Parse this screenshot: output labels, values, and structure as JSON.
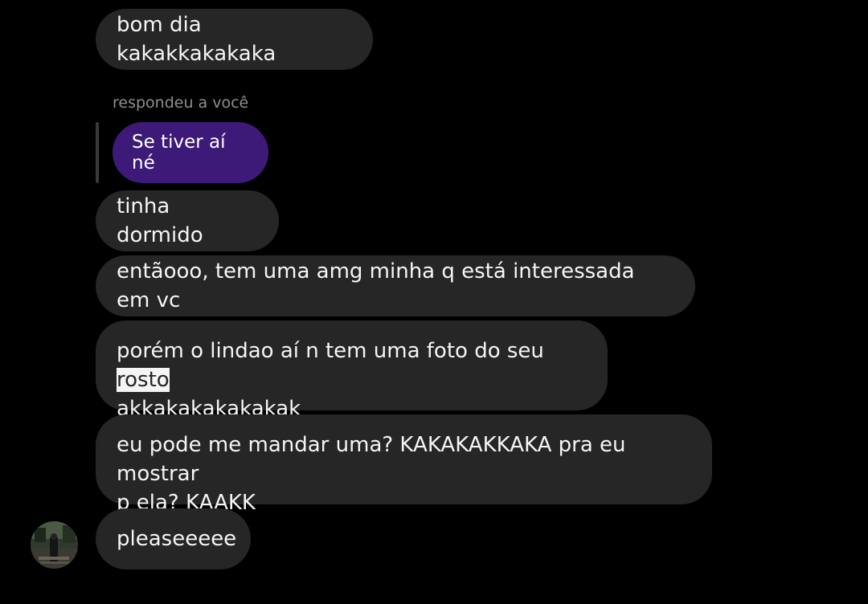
{
  "messages": [
    {
      "text": "bom dia kakakkakakaka"
    },
    {
      "text": "tinha dormido"
    },
    {
      "text": "entãooo, tem uma amg minha q está interessada em vc"
    },
    {
      "text_line1_before": "porém o lindao aí n tem uma foto do seu ",
      "highlight": "rosto",
      "text_line2": "akkakakakakakak"
    },
    {
      "line1": "eu pode me mandar uma? KAKAKAKKAKA pra eu mostrar",
      "line2": "p ela? KAAKK"
    },
    {
      "text": "pleaseeeee"
    }
  ],
  "reply": {
    "label": "respondeu a você",
    "quoted_text": "Se tiver aí né"
  },
  "colors": {
    "background": "#000000",
    "bubble": "#262626",
    "reply_bubble": "#3d1a78",
    "reply_label": "#8e8e8e"
  }
}
